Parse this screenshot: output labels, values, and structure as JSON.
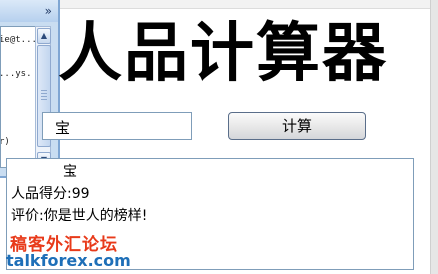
{
  "panel": {
    "items": [
      "ie@t...",
      "...ys.",
      "r)"
    ],
    "chevron_glyph": "»"
  },
  "app": {
    "title": "人品计算器",
    "name_input_value": "宝",
    "calculate_label": "计算"
  },
  "result": {
    "name_fragment": "宝",
    "score_line": "人品得分:99",
    "evaluation_line": "评价:你是世人的榜样!"
  },
  "watermark": {
    "chinese": "稿客外汇论坛",
    "english": "talkforex.com"
  },
  "colors": {
    "watermark_red": "#e83a1a",
    "watermark_blue": "#1e6fb8",
    "panel_blue": "#c9ddf1"
  }
}
